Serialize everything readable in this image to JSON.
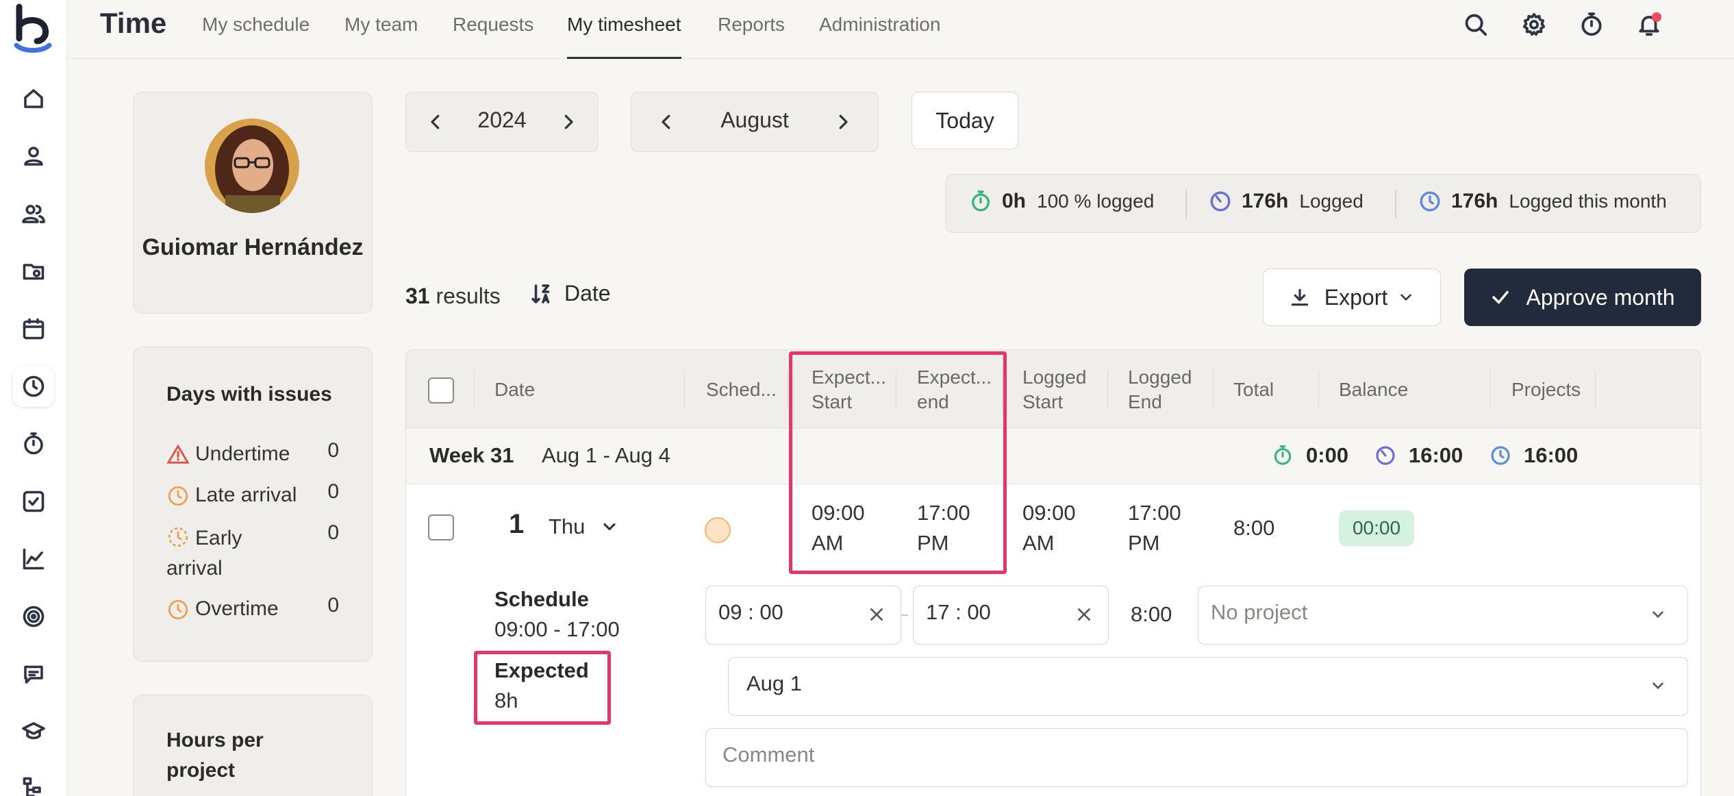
{
  "app": {
    "title": "Time"
  },
  "nav": {
    "tabs": [
      "My schedule",
      "My team",
      "Requests",
      "My timesheet",
      "Reports",
      "Administration"
    ],
    "active": "My timesheet"
  },
  "rail": {
    "items": [
      "home-icon",
      "person-icon",
      "people-icon",
      "folder-icon",
      "calendar-icon",
      "clock-icon",
      "stopwatch-icon",
      "checkbox-icon",
      "chart-icon",
      "target-icon",
      "chat-icon",
      "graduation-cap-icon",
      "org-chart-icon"
    ],
    "active": "clock-icon"
  },
  "colors": {
    "accent": "#212b3b",
    "highlight": "#e8336c",
    "green": "#3ab67a",
    "purple": "#6b6fd6",
    "blue": "#5c8be0",
    "orange": "#f0a055",
    "red": "#e2504a"
  },
  "profile": {
    "name": "Guiomar Hernández"
  },
  "issues": {
    "title": "Days with issues",
    "items": [
      {
        "label": "Undertime",
        "count": "0",
        "icon": "warning-icon"
      },
      {
        "label": "Late arrival",
        "count": "0",
        "icon": "clock-orange-icon"
      },
      {
        "label": "Early arrival",
        "count": "0",
        "icon": "clock-dashed-icon"
      },
      {
        "label": "Overtime",
        "count": "0",
        "icon": "clock-orange-icon"
      }
    ]
  },
  "hours_per_project": {
    "title": "Hours per project"
  },
  "controls": {
    "year": "2024",
    "month": "August",
    "today_label": "Today"
  },
  "stats": {
    "pct": {
      "value": "0h",
      "label": "100 % logged"
    },
    "logged": {
      "value": "176h",
      "label": "Logged"
    },
    "month": {
      "value": "176h",
      "label": "Logged this month"
    }
  },
  "toolbar": {
    "results_count": "31",
    "results_label": "results",
    "sort_label": "Date",
    "export_label": "Export",
    "approve_label": "Approve month"
  },
  "table": {
    "headers": {
      "date": "Date",
      "schedule": "Sched...",
      "expected_start": "Expect... Start",
      "expected_end": "Expect... end",
      "logged_start": "Logged Start",
      "logged_end": "Logged End",
      "total": "Total",
      "balance": "Balance",
      "projects": "Projects"
    },
    "week": {
      "title": "Week 31",
      "range": "Aug 1 - Aug 4",
      "s1": "0:00",
      "s2": "16:00",
      "s3": "16:00"
    },
    "row": {
      "day_num": "1",
      "day_name": "Thu",
      "expected_start": "09:00 AM",
      "expected_end": "17:00 PM",
      "logged_start": "09:00 AM",
      "logged_end": "17:00 PM",
      "total": "8:00",
      "balance": "00:00"
    },
    "detail": {
      "schedule_label": "Schedule",
      "schedule_value": "09:00 - 17:00",
      "expected_label": "Expected",
      "expected_value": "8h",
      "start_time": "09 : 00",
      "end_time": "17 : 00",
      "duration": "8:00",
      "project_placeholder": "No project",
      "date_value": "Aug 1",
      "comment_placeholder": "Comment"
    }
  }
}
